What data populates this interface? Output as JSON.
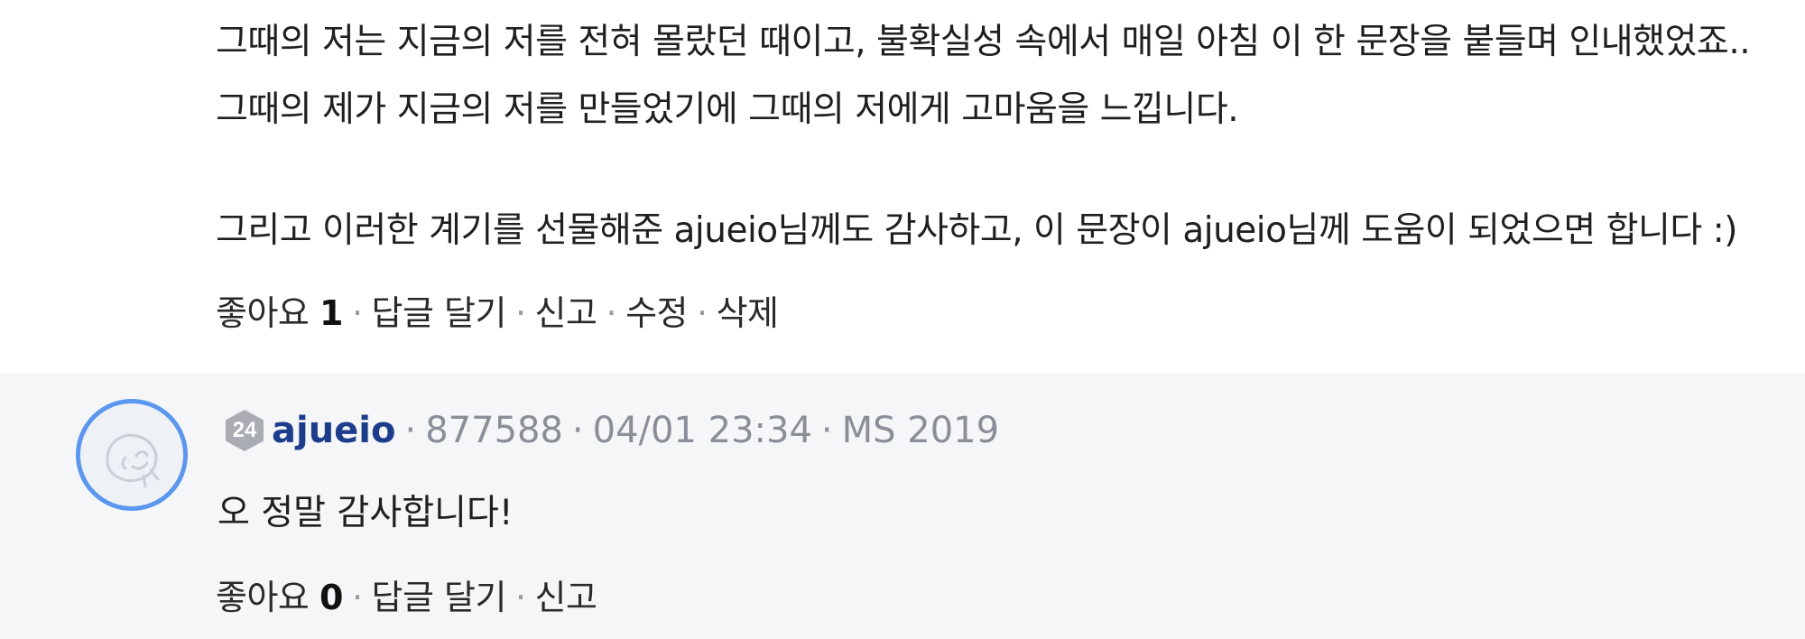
{
  "comment": {
    "lines": [
      "그때의 저는 지금의 저를 전혀 몰랐던 때이고, 불확실성 속에서 매일 아침 이 한 문장을 붙들며 인내했었죠..",
      "그때의 제가 지금의 저를 만들었기에 그때의 저에게 고마움을 느낍니다.",
      "그리고 이러한 계기를 선물해준 ajueio님께도 감사하고, 이 문장이 ajueio님께 도움이 되었으면 합니다 :)"
    ],
    "actions": {
      "like_label": "좋아요",
      "like_count": "1",
      "reply_label": "답글 달기",
      "report_label": "신고",
      "edit_label": "수정",
      "delete_label": "삭제"
    }
  },
  "reply": {
    "level": "24",
    "username": "ajueio",
    "user_id": "877588",
    "timestamp": "04/01 23:34",
    "tag": "MS 2019",
    "text": "오 정말 감사합니다!",
    "actions": {
      "like_label": "좋아요",
      "like_count": "0",
      "reply_label": "답글 달기",
      "report_label": "신고"
    }
  },
  "colors": {
    "username": "#1e3c8c",
    "avatar_border": "#5b96ef",
    "reply_bg": "#f4f6f8",
    "meta_text": "#8a8f97"
  }
}
